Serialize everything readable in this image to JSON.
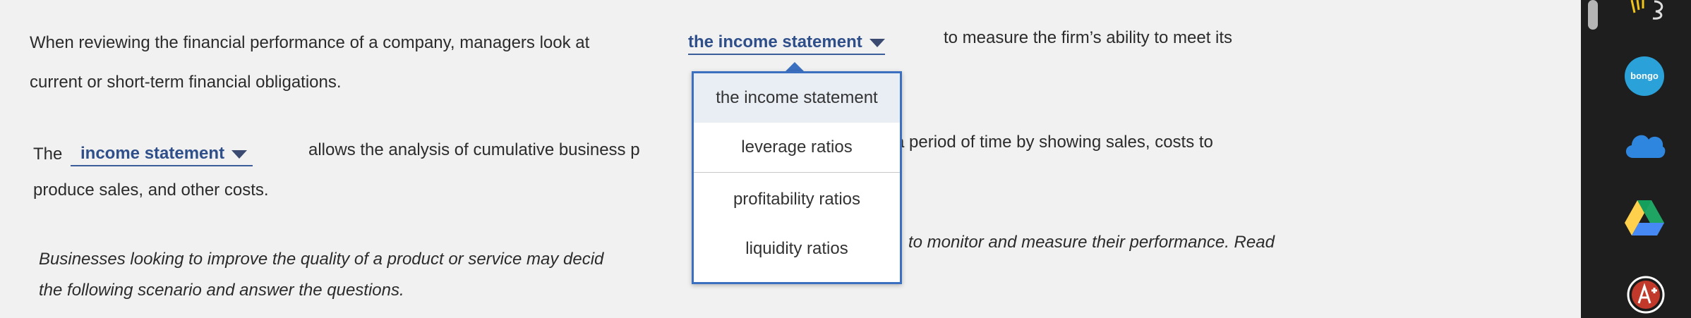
{
  "paragraph1": {
    "before": "When reviewing the financial performance of a company, managers look at",
    "dropdown_value": "the income statement",
    "after": "to measure the firm’s ability to meet its",
    "line2": "current or short-term financial obligations."
  },
  "paragraph2": {
    "before": "The",
    "dropdown_value": "income statement",
    "after": "allows the analysis of cumulative business p",
    "after_right": "a period of time by showing sales, costs to",
    "line2": "produce sales, and other costs."
  },
  "paragraph3": {
    "before": "Businesses looking to improve the quality of a product or service may decid",
    "after_right": "to monitor and measure their performance. Read",
    "line2": "the following scenario and answer the questions."
  },
  "dropdown_options": [
    "the income statement",
    "leverage ratios",
    "profitability ratios",
    "liquidity ratios"
  ],
  "sidebar": {
    "bongo_label": "bongo"
  }
}
